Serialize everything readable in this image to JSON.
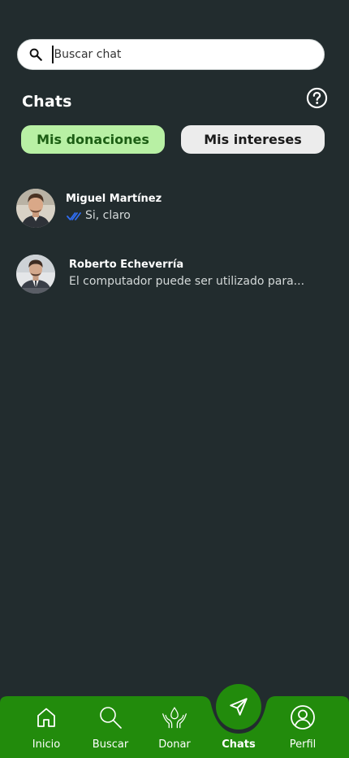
{
  "search": {
    "placeholder": "Buscar chat",
    "value": "",
    "icon": "search-icon"
  },
  "header": {
    "title": "Chats",
    "help_icon": "question-circle-icon"
  },
  "tabs": [
    {
      "label": "Mis donaciones",
      "active": true
    },
    {
      "label": "Mis intereses",
      "active": false
    }
  ],
  "chats": [
    {
      "name": "Miguel Martínez",
      "last_message": "Si, claro",
      "read_receipt": "double-check-icon"
    },
    {
      "name": "Roberto Echeverría",
      "last_message": "El computador puede ser utilizado para..."
    }
  ],
  "nav": {
    "items": [
      {
        "label": "Inicio",
        "icon": "home-icon"
      },
      {
        "label": "Buscar",
        "icon": "search-icon"
      },
      {
        "label": "Donar",
        "icon": "donate-hands-icon"
      },
      {
        "label": "Chats",
        "icon": "send-icon",
        "active": true
      },
      {
        "label": "Perfil",
        "icon": "user-icon"
      }
    ]
  },
  "colors": {
    "background": "#222c2e",
    "nav_green": "#228b0c",
    "tab_active_bg": "#b8f0a4",
    "tab_active_text": "#1c5e14",
    "tab_inactive_bg": "#ececec",
    "read_tick": "#2f6cf0"
  }
}
